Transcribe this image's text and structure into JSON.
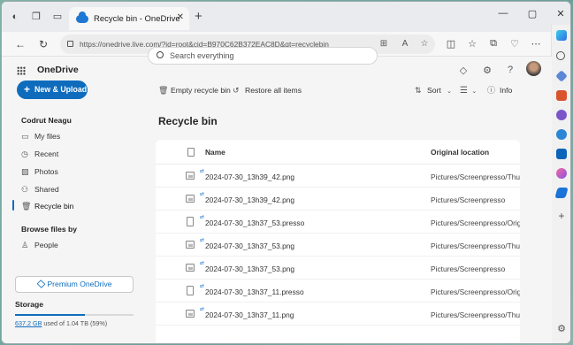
{
  "browser": {
    "tab_title": "Recycle bin - OneDrive",
    "url": "https://onedrive.live.com/?id=root&cid=B970C62B372EAC8D&qt=recyclebin"
  },
  "app": {
    "brand": "OneDrive",
    "search_placeholder": "Search everything"
  },
  "sidebar": {
    "new_button": "New & Upload",
    "user_name": "Codrut Neagu",
    "items": [
      {
        "label": "My files",
        "icon": "folder-icon"
      },
      {
        "label": "Recent",
        "icon": "clock-icon"
      },
      {
        "label": "Photos",
        "icon": "image-icon"
      },
      {
        "label": "Shared",
        "icon": "people-icon"
      },
      {
        "label": "Recycle bin",
        "icon": "trash-icon"
      }
    ],
    "browse_section": "Browse files by",
    "browse_items": [
      {
        "label": "People",
        "icon": "person-icon"
      }
    ],
    "premium_button": "Premium OneDrive",
    "storage_title": "Storage",
    "storage_used": "637.2 GB",
    "storage_rest": " used of 1.04 TB (59%)",
    "storage_fraction": 0.59
  },
  "toolbar": {
    "empty_recycle_bin": "Empty recycle bin",
    "restore_all": "Restore all items",
    "sort": "Sort",
    "info": "Info"
  },
  "main": {
    "title": "Recycle bin",
    "columns": {
      "name": "Name",
      "location": "Original location"
    },
    "rows": [
      {
        "name": "2024-07-30_13h39_42.png",
        "location": "Pictures/Screenpresso/Thumb",
        "type": "image"
      },
      {
        "name": "2024-07-30_13h39_42.png",
        "location": "Pictures/Screenpresso",
        "type": "image"
      },
      {
        "name": "2024-07-30_13h37_53.presso",
        "location": "Pictures/Screenpresso/Origin",
        "type": "doc"
      },
      {
        "name": "2024-07-30_13h37_53.png",
        "location": "Pictures/Screenpresso/Thumb",
        "type": "image"
      },
      {
        "name": "2024-07-30_13h37_53.png",
        "location": "Pictures/Screenpresso",
        "type": "image"
      },
      {
        "name": "2024-07-30_13h37_11.presso",
        "location": "Pictures/Screenpresso/Origin",
        "type": "doc"
      },
      {
        "name": "2024-07-30_13h37_11.png",
        "location": "Pictures/Screenpresso/Thumb",
        "type": "image"
      }
    ]
  },
  "colors": {
    "accent": "#0f6cbd"
  }
}
